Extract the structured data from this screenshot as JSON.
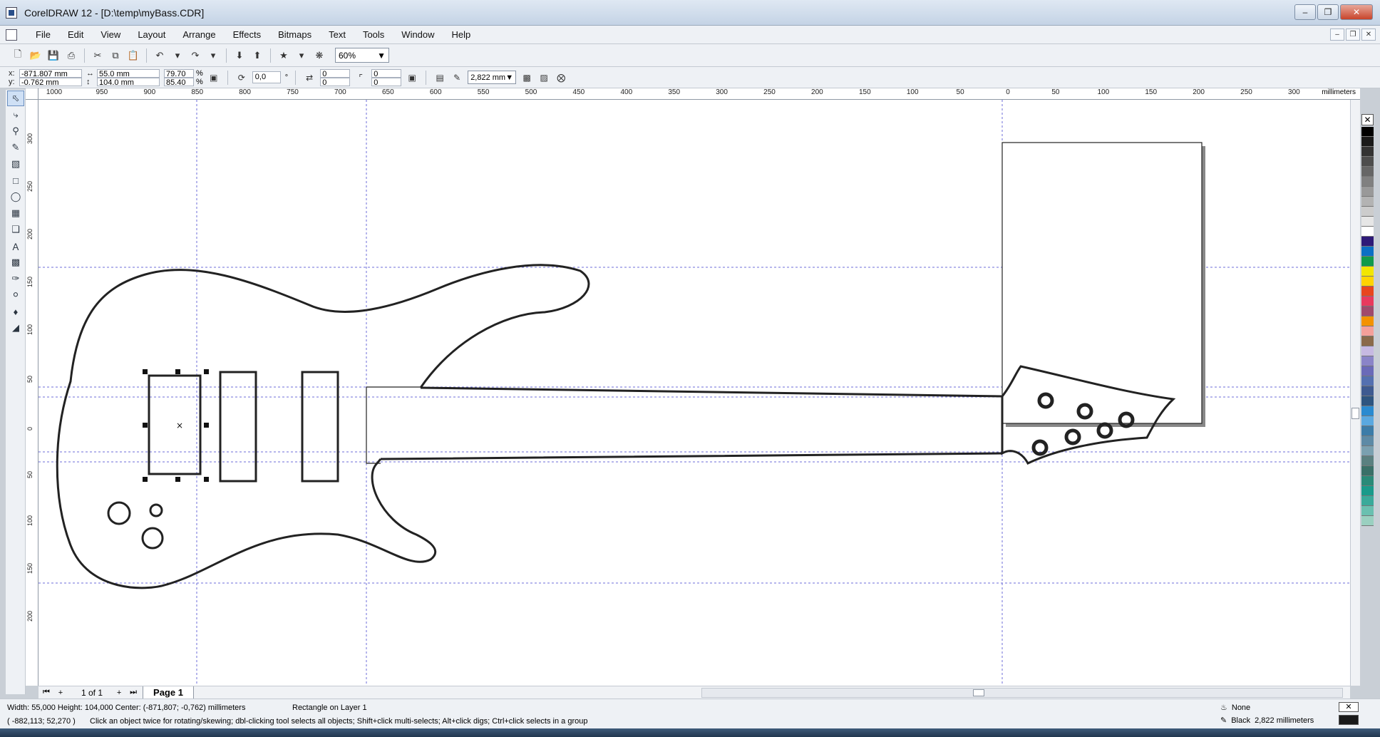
{
  "window": {
    "title": "CorelDRAW 12 - [D:\\temp\\myBass.CDR]"
  },
  "menu": [
    "File",
    "Edit",
    "View",
    "Layout",
    "Arrange",
    "Effects",
    "Bitmaps",
    "Text",
    "Tools",
    "Window",
    "Help"
  ],
  "toolbar": {
    "zoom": "60%"
  },
  "propbar": {
    "x": "-871.807 mm",
    "y": "-0.762 mm",
    "width": "55.0 mm",
    "height": "104.0 mm",
    "scale_x": "79.70",
    "scale_y": "85.40",
    "scale_unit": "%",
    "x_label": "x:",
    "y_label": "y:",
    "rotation": "0,0",
    "degree": "°",
    "corner_a": "0",
    "corner_b": "0",
    "corner_c": "0",
    "corner_d": "0",
    "outline_width": "2,822 mm"
  },
  "ruler_h": {
    "unit": "millimeters",
    "labels": [
      "1000",
      "950",
      "900",
      "850",
      "800",
      "750",
      "700",
      "650",
      "600",
      "550",
      "500",
      "450",
      "400",
      "350",
      "300",
      "250",
      "200",
      "150",
      "100",
      "50",
      "0",
      "50",
      "100",
      "150",
      "200",
      "250",
      "300"
    ]
  },
  "ruler_v": {
    "unit": "millimeters",
    "labels": [
      "300",
      "250",
      "200",
      "150",
      "100",
      "50",
      "0",
      "50",
      "100",
      "150",
      "200"
    ]
  },
  "pages": {
    "count": "1 of 1",
    "tab": "Page 1"
  },
  "status": {
    "dimensions": "Width: 55,000  Height: 104,000  Center: (-871,807; -0,762)  millimeters",
    "object": "Rectangle on Layer 1",
    "cursor": "( -882,113; 52,270 )",
    "hint": "Click an object twice for rotating/skewing; dbl-clicking tool selects all objects; Shift+click multi-selects; Alt+click digs; Ctrl+click selects in a group",
    "fill": "None",
    "outline_color": "Black",
    "outline_width": "2,822 millimeters"
  },
  "palette_colors": [
    "#000000",
    "#1a1a1a",
    "#333333",
    "#4d4d4d",
    "#666666",
    "#808080",
    "#999999",
    "#b3b3b3",
    "#cccccc",
    "#e6e6e6",
    "#ffffff",
    "#2e1a78",
    "#0b6fc4",
    "#119a4a",
    "#f2e600",
    "#ffd400",
    "#e8461e",
    "#e83a5e",
    "#a04a6c",
    "#f39200",
    "#f4a09a",
    "#8a6a4a",
    "#c6b9e2",
    "#8a84c8",
    "#6a6ab8",
    "#5470b0",
    "#3e5a90",
    "#2e5580",
    "#2a8ad0",
    "#5aa8e0",
    "#3c7ca8",
    "#5d8aa6",
    "#7aa0b0",
    "#5a8080",
    "#3a7068",
    "#2a8a78",
    "#1a9a8a",
    "#3aaa9a",
    "#6ac0b0",
    "#9ad0c0"
  ]
}
